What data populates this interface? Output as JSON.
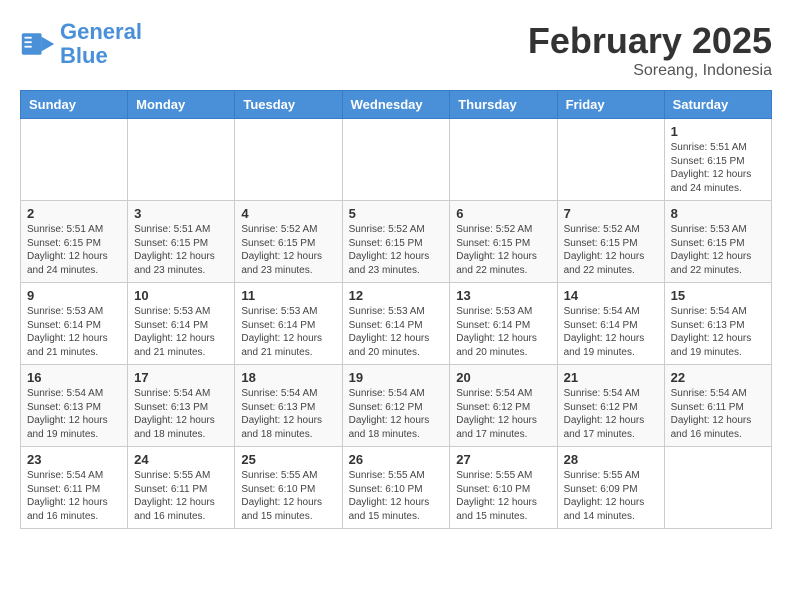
{
  "header": {
    "logo_line1": "General",
    "logo_line2": "Blue",
    "month_title": "February 2025",
    "location": "Soreang, Indonesia"
  },
  "weekdays": [
    "Sunday",
    "Monday",
    "Tuesday",
    "Wednesday",
    "Thursday",
    "Friday",
    "Saturday"
  ],
  "weeks": [
    [
      {
        "day": "",
        "info": ""
      },
      {
        "day": "",
        "info": ""
      },
      {
        "day": "",
        "info": ""
      },
      {
        "day": "",
        "info": ""
      },
      {
        "day": "",
        "info": ""
      },
      {
        "day": "",
        "info": ""
      },
      {
        "day": "1",
        "info": "Sunrise: 5:51 AM\nSunset: 6:15 PM\nDaylight: 12 hours\nand 24 minutes."
      }
    ],
    [
      {
        "day": "2",
        "info": "Sunrise: 5:51 AM\nSunset: 6:15 PM\nDaylight: 12 hours\nand 24 minutes."
      },
      {
        "day": "3",
        "info": "Sunrise: 5:51 AM\nSunset: 6:15 PM\nDaylight: 12 hours\nand 23 minutes."
      },
      {
        "day": "4",
        "info": "Sunrise: 5:52 AM\nSunset: 6:15 PM\nDaylight: 12 hours\nand 23 minutes."
      },
      {
        "day": "5",
        "info": "Sunrise: 5:52 AM\nSunset: 6:15 PM\nDaylight: 12 hours\nand 23 minutes."
      },
      {
        "day": "6",
        "info": "Sunrise: 5:52 AM\nSunset: 6:15 PM\nDaylight: 12 hours\nand 22 minutes."
      },
      {
        "day": "7",
        "info": "Sunrise: 5:52 AM\nSunset: 6:15 PM\nDaylight: 12 hours\nand 22 minutes."
      },
      {
        "day": "8",
        "info": "Sunrise: 5:53 AM\nSunset: 6:15 PM\nDaylight: 12 hours\nand 22 minutes."
      }
    ],
    [
      {
        "day": "9",
        "info": "Sunrise: 5:53 AM\nSunset: 6:14 PM\nDaylight: 12 hours\nand 21 minutes."
      },
      {
        "day": "10",
        "info": "Sunrise: 5:53 AM\nSunset: 6:14 PM\nDaylight: 12 hours\nand 21 minutes."
      },
      {
        "day": "11",
        "info": "Sunrise: 5:53 AM\nSunset: 6:14 PM\nDaylight: 12 hours\nand 21 minutes."
      },
      {
        "day": "12",
        "info": "Sunrise: 5:53 AM\nSunset: 6:14 PM\nDaylight: 12 hours\nand 20 minutes."
      },
      {
        "day": "13",
        "info": "Sunrise: 5:53 AM\nSunset: 6:14 PM\nDaylight: 12 hours\nand 20 minutes."
      },
      {
        "day": "14",
        "info": "Sunrise: 5:54 AM\nSunset: 6:14 PM\nDaylight: 12 hours\nand 19 minutes."
      },
      {
        "day": "15",
        "info": "Sunrise: 5:54 AM\nSunset: 6:13 PM\nDaylight: 12 hours\nand 19 minutes."
      }
    ],
    [
      {
        "day": "16",
        "info": "Sunrise: 5:54 AM\nSunset: 6:13 PM\nDaylight: 12 hours\nand 19 minutes."
      },
      {
        "day": "17",
        "info": "Sunrise: 5:54 AM\nSunset: 6:13 PM\nDaylight: 12 hours\nand 18 minutes."
      },
      {
        "day": "18",
        "info": "Sunrise: 5:54 AM\nSunset: 6:13 PM\nDaylight: 12 hours\nand 18 minutes."
      },
      {
        "day": "19",
        "info": "Sunrise: 5:54 AM\nSunset: 6:12 PM\nDaylight: 12 hours\nand 18 minutes."
      },
      {
        "day": "20",
        "info": "Sunrise: 5:54 AM\nSunset: 6:12 PM\nDaylight: 12 hours\nand 17 minutes."
      },
      {
        "day": "21",
        "info": "Sunrise: 5:54 AM\nSunset: 6:12 PM\nDaylight: 12 hours\nand 17 minutes."
      },
      {
        "day": "22",
        "info": "Sunrise: 5:54 AM\nSunset: 6:11 PM\nDaylight: 12 hours\nand 16 minutes."
      }
    ],
    [
      {
        "day": "23",
        "info": "Sunrise: 5:54 AM\nSunset: 6:11 PM\nDaylight: 12 hours\nand 16 minutes."
      },
      {
        "day": "24",
        "info": "Sunrise: 5:55 AM\nSunset: 6:11 PM\nDaylight: 12 hours\nand 16 minutes."
      },
      {
        "day": "25",
        "info": "Sunrise: 5:55 AM\nSunset: 6:10 PM\nDaylight: 12 hours\nand 15 minutes."
      },
      {
        "day": "26",
        "info": "Sunrise: 5:55 AM\nSunset: 6:10 PM\nDaylight: 12 hours\nand 15 minutes."
      },
      {
        "day": "27",
        "info": "Sunrise: 5:55 AM\nSunset: 6:10 PM\nDaylight: 12 hours\nand 15 minutes."
      },
      {
        "day": "28",
        "info": "Sunrise: 5:55 AM\nSunset: 6:09 PM\nDaylight: 12 hours\nand 14 minutes."
      },
      {
        "day": "",
        "info": ""
      }
    ]
  ]
}
